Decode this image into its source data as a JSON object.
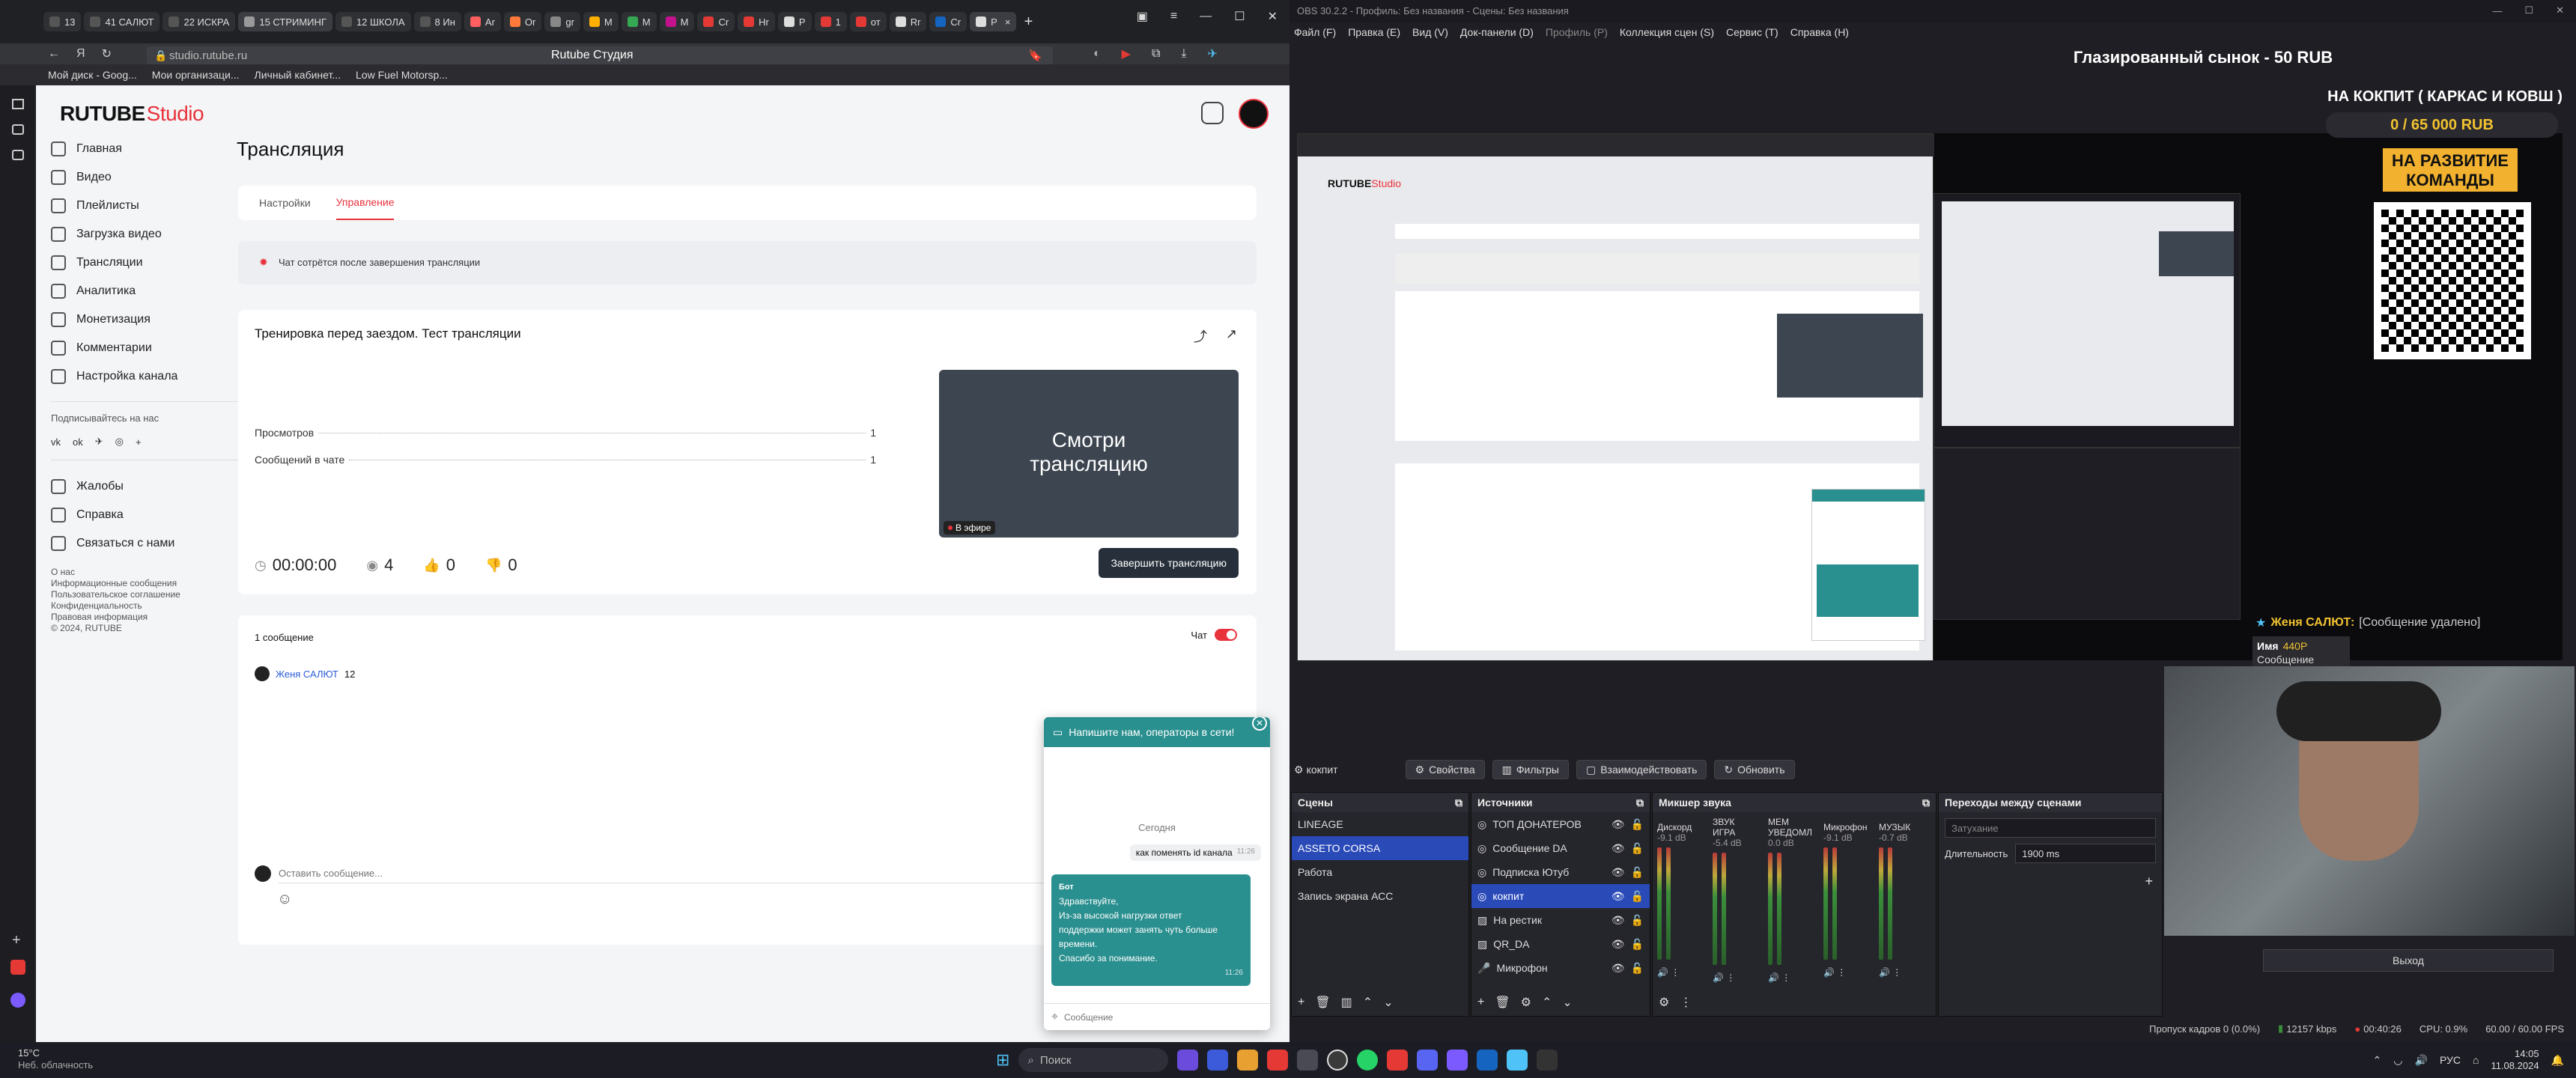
{
  "browser": {
    "tabs": [
      {
        "label": "13",
        "color": "#555"
      },
      {
        "label": "41 САЛЮТ",
        "color": "#555"
      },
      {
        "label": "22 ИСКРА",
        "color": "#555"
      },
      {
        "label": "15 СТРИМИНГ",
        "color": "#777"
      },
      {
        "label": "12 ШКОЛА",
        "color": "#555"
      },
      {
        "label": "8 Ин",
        "color": "#555"
      },
      {
        "label": "Ar",
        "color": "#ff5f5f"
      },
      {
        "label": "Or",
        "color": "#ff7a3a"
      },
      {
        "label": "gr",
        "color": "#888"
      },
      {
        "label": "M",
        "color": "#ffb000"
      },
      {
        "label": "M",
        "color": "#34a853"
      },
      {
        "label": "M",
        "color": "#c4128e"
      },
      {
        "label": "Cr",
        "color": "#e53935"
      },
      {
        "label": "Hr",
        "color": "#e53935"
      },
      {
        "label": "Р",
        "color": "#ddd"
      },
      {
        "label": "1",
        "color": "#e53935"
      },
      {
        "label": "от",
        "color": "#e53935"
      },
      {
        "label": "Rr",
        "color": "#ddd"
      },
      {
        "label": "Cr",
        "color": "#1565c0"
      },
      {
        "label": "Р",
        "color": "#ddd"
      }
    ],
    "page_title": "Rutube Студия",
    "url": "studio.rutube.ru",
    "bookmarks": [
      "Мой диск - Goog...",
      "Мои организаци...",
      "Личный кабинет...",
      "Low Fuel Motorsp..."
    ]
  },
  "rutube": {
    "logo": "RUTUBE",
    "logo_suffix": "Studio",
    "nav": [
      "Главная",
      "Видео",
      "Плейлисты",
      "Загрузка видео",
      "Трансляции",
      "Аналитика",
      "Монетизация",
      "Комментарии",
      "Настройка канала"
    ],
    "subscribe_label": "Подписывайтесь на нас",
    "help_nav": [
      "Жалобы",
      "Справка",
      "Связаться с нами"
    ],
    "footer_links": [
      "О нас",
      "Информационные сообщения",
      "Пользовательское соглашение",
      "Конфиденциальность",
      "Правовая информация",
      "© 2024, RUTUBE"
    ],
    "page_title": "Трансляция",
    "tabs": [
      "Настройки",
      "Управление"
    ],
    "notice": "Чат сотрётся после завершения трансляции",
    "stream_title": "Тренировка перед заездом. Тест трансляции",
    "stats": [
      {
        "label": "Просмотров",
        "value": "1"
      },
      {
        "label": "Сообщений в чате",
        "value": "1"
      }
    ],
    "preview_text_1": "Смотри",
    "preview_text_2": "трансляцию",
    "live_badge": "В эфире",
    "timer": "00:00:00",
    "viewers": "4",
    "likes": "0",
    "dislikes": "0",
    "end_button": "Завершить трансляцию",
    "messages_count": "1 сообщение",
    "chat_label": "Чат",
    "message_author": "Женя САЛЮТ",
    "message_text": "12",
    "input_placeholder": "Оставить сообщение..."
  },
  "support_chat": {
    "title": "Напишите нам, операторы в сети!",
    "day": "Сегодня",
    "user_msg": "как поменять id канала",
    "user_time": "11:26",
    "bot_name": "Бот",
    "bot_msg_1": "Здравствуйте,",
    "bot_msg_2": "Из-за высокой нагрузки ответ",
    "bot_msg_3": "поддержки может занять чуть больше",
    "bot_msg_4": "времени.",
    "bot_msg_5": "Спасибо за понимание.",
    "bot_time": "11:26",
    "input_placeholder": "Сообщение"
  },
  "obs": {
    "title": "OBS 30.2.2 - Профиль: Без названия - Сцены: Без названия",
    "menu": [
      "Файл (F)",
      "Правка (E)",
      "Вид (V)",
      "Док-панели (D)",
      "Профиль (P)",
      "Коллекция сцен (S)",
      "Сервис (T)",
      "Справка (H)"
    ],
    "overlay_title": "Глазированный сынок - 50 RUB",
    "goal_title": "НА КОКПИТ ( КАРКАС И КОВШ )",
    "goal_value": "0 / 65 000 RUB",
    "dev_label_1": "НА РАЗВИТИЕ",
    "dev_label_2": "КОМАНДЫ",
    "chat_user": "Женя САЛЮТ:",
    "chat_deleted": "[Сообщение удалено]",
    "chat_name_label": "Имя",
    "chat_name_count": "440Р",
    "chat_message_label": "Сообщение",
    "source_label": "кокпит",
    "toolbar": [
      "Свойства",
      "Фильтры",
      "Взаимодействовать",
      "Обновить"
    ],
    "scenes_title": "Сцены",
    "scenes": [
      "LINEAGE",
      "ASSETO CORSA",
      "Работа",
      "Запись экрана АСС"
    ],
    "sources_title": "Источники",
    "sources": [
      "ТОП ДОНАТЕРОВ",
      "Сообщение DA",
      "Подписка Ютуб",
      "кокпит",
      "На рестик",
      "QR_DA",
      "Микрофон"
    ],
    "mixer_title": "Микшер звука",
    "mixer": [
      {
        "name": "Дискорд",
        "db": "-9.1 dB"
      },
      {
        "name": "ЗВУК ИГРА",
        "db": "-5.4 dB"
      },
      {
        "name": "МЕМ УВЕДОМЛ",
        "db": "0.0 dB"
      },
      {
        "name": "Микрофон",
        "db": "-9.1 dB"
      },
      {
        "name": "МУЗЫК",
        "db": "-0.7 dB"
      }
    ],
    "transitions_title": "Переходы между сценами",
    "transition_type": "Затухание",
    "duration_label": "Длительность",
    "duration_value": "1900 ms",
    "exit_label": "Выход",
    "status": {
      "dropped": "Пропуск кадров 0 (0.0%)",
      "bitrate": "12157 kbps",
      "time": "00:40:26",
      "cpu": "CPU: 0.9%",
      "fps": "60.00 / 60.00 FPS"
    }
  },
  "taskbar": {
    "temp": "15°C",
    "weather": "Неб. облачность",
    "search": "Поиск",
    "lang": "РУС",
    "time": "14:05",
    "date": "11.08.2024"
  },
  "colors": {
    "rutube_accent": "#e8323c",
    "teal": "#2a8f8f",
    "obs_selected": "#2a4ab8",
    "gold": "#f2c230"
  }
}
